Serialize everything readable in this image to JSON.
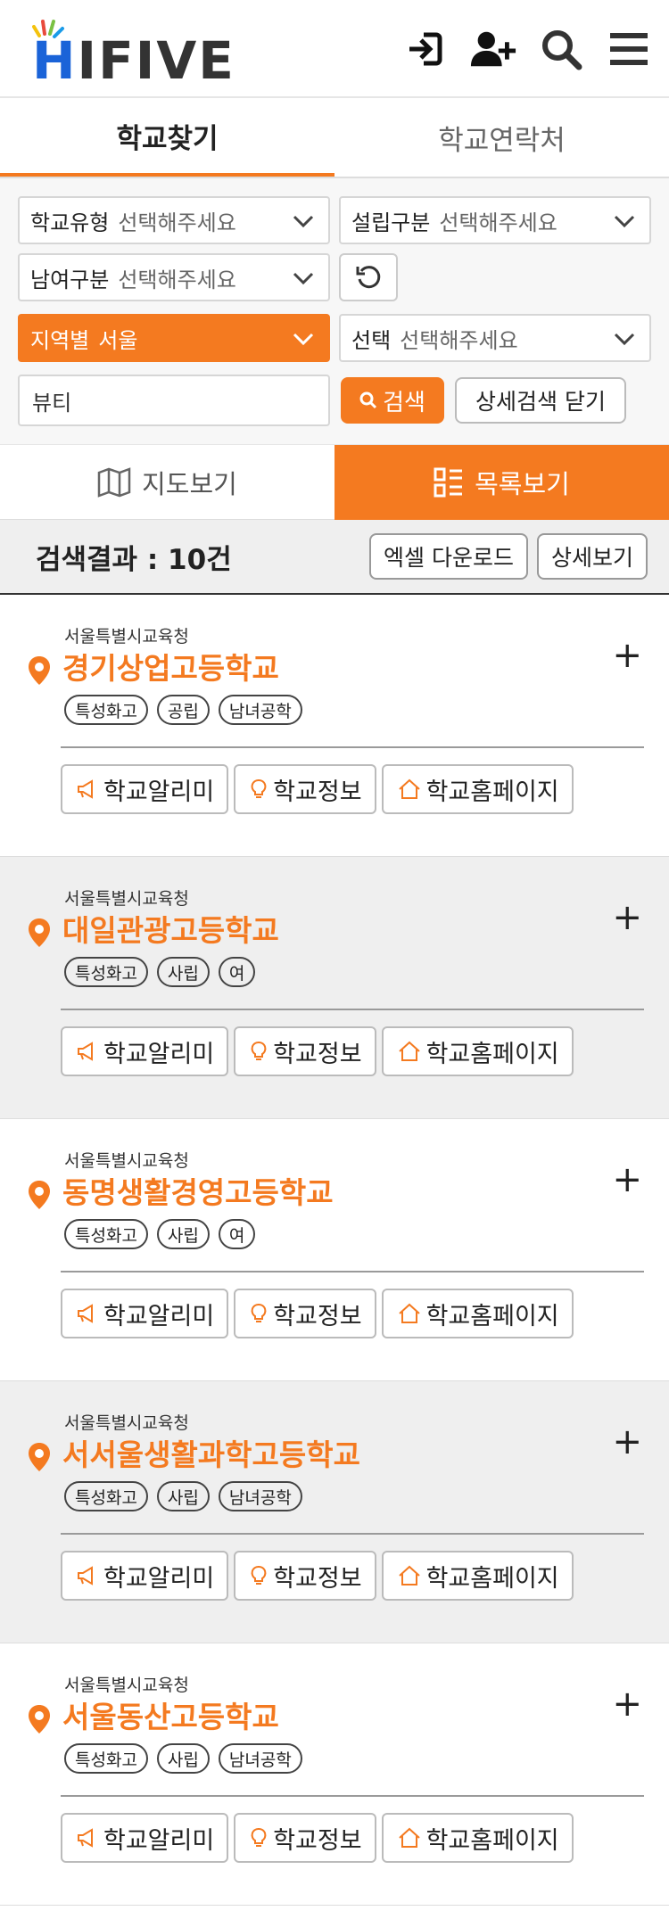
{
  "header": {
    "logo_h": "H",
    "logo_rest": "IFIVE",
    "icons": [
      "login-icon",
      "signup-icon",
      "search-icon",
      "menu-icon"
    ]
  },
  "tabs": [
    {
      "label": "학교찾기",
      "active": true
    },
    {
      "label": "학교연락처",
      "active": false
    }
  ],
  "filters": {
    "school_type": {
      "label": "학교유형",
      "value": "선택해주세요"
    },
    "founding": {
      "label": "설립구분",
      "value": "선택해주세요"
    },
    "gender": {
      "label": "남여구분",
      "value": "선택해주세요"
    },
    "region": {
      "label": "지역별",
      "value": "서울"
    },
    "sub_region": {
      "label": "선택",
      "value": "선택해주세요"
    },
    "keyword": "뷰티",
    "search_label": "검색",
    "detail_close_label": "상세검색 닫기"
  },
  "views": {
    "map_label": "지도보기",
    "list_label": "목록보기"
  },
  "results": {
    "title": "검색결과 : 10건",
    "excel_label": "엑셀 다운로드",
    "detail_label": "상세보기"
  },
  "card_buttons": {
    "notice": "학교알리미",
    "info": "학교정보",
    "homepage": "학교홈페이지"
  },
  "schools": [
    {
      "office": "서울특별시교육청",
      "name": "경기상업고등학교",
      "tags": [
        "특성화고",
        "공립",
        "남녀공학"
      ]
    },
    {
      "office": "서울특별시교육청",
      "name": "대일관광고등학교",
      "tags": [
        "특성화고",
        "사립",
        "여"
      ]
    },
    {
      "office": "서울특별시교육청",
      "name": "동명생활경영고등학교",
      "tags": [
        "특성화고",
        "사립",
        "여"
      ]
    },
    {
      "office": "서울특별시교육청",
      "name": "서서울생활과학고등학교",
      "tags": [
        "특성화고",
        "사립",
        "남녀공학"
      ]
    },
    {
      "office": "서울특별시교육청",
      "name": "서울동산고등학교",
      "tags": [
        "특성화고",
        "사립",
        "남녀공학"
      ]
    }
  ],
  "colors": {
    "accent": "#f47a20",
    "logo_blue": "#1a63d8"
  }
}
